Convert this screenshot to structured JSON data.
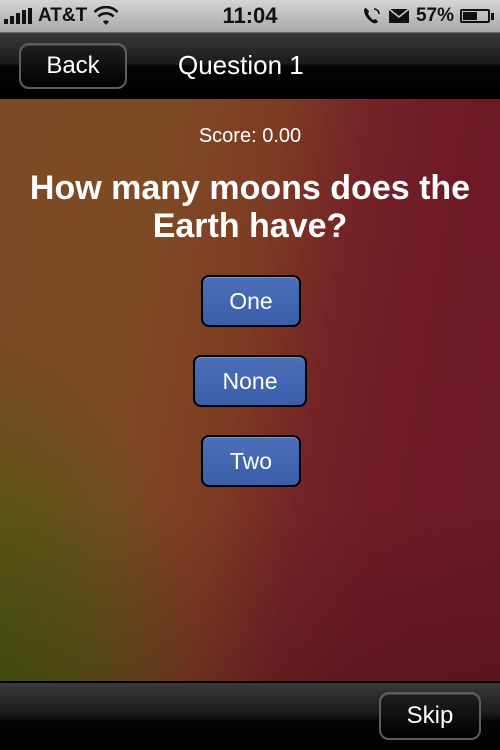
{
  "status_bar": {
    "carrier": "AT&T",
    "time": "11:04",
    "battery_text": "57%",
    "battery_level": 0.57,
    "icons": [
      "signal-icon",
      "wifi-icon",
      "phone-icon",
      "mail-icon",
      "battery-icon"
    ]
  },
  "nav": {
    "back_label": "Back",
    "title": "Question 1"
  },
  "quiz": {
    "score": "Score: 0.00",
    "question": "How many moons does the Earth have?",
    "answers": [
      "One",
      "None",
      "Two"
    ]
  },
  "toolbar": {
    "skip_label": "Skip"
  },
  "colors": {
    "answer_button": "#3a5ea8",
    "background_left": "#7c4a24",
    "background_right": "#6c1726",
    "background_glow": "#46580f"
  }
}
